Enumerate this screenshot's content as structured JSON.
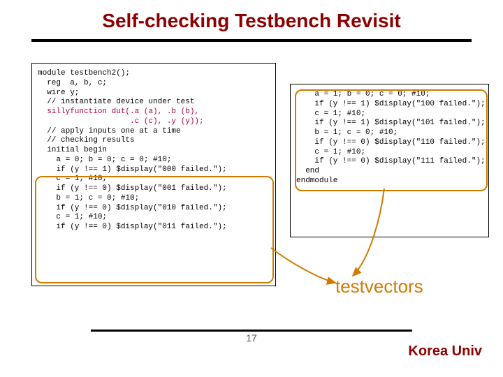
{
  "title": "Self-checking Testbench Revisit",
  "left_code": [
    {
      "t": "module testbench2();"
    },
    {
      "t": "  reg  a, b, c;"
    },
    {
      "t": "  wire y;"
    },
    {
      "t": ""
    },
    {
      "t": "  // instantiate device under test"
    },
    {
      "hl": "  sillyfunction dut(.a (a), .b (b),"
    },
    {
      "hl": "                    .c (c), .y (y));"
    },
    {
      "t": ""
    },
    {
      "t": ""
    },
    {
      "t": "  // apply inputs one at a time"
    },
    {
      "t": "  // checking results"
    },
    {
      "t": "  initial begin"
    },
    {
      "t": "    a = 0; b = 0; c = 0; #10;"
    },
    {
      "t": "    if (y !== 1) $display(\"000 failed.\");"
    },
    {
      "t": "    c = 1; #10;"
    },
    {
      "t": "    if (y !== 0) $display(\"001 failed.\");"
    },
    {
      "t": "    b = 1; c = 0; #10;"
    },
    {
      "t": "    if (y !== 0) $display(\"010 failed.\");"
    },
    {
      "t": "    c = 1; #10;"
    },
    {
      "t": "    if (y !== 0) $display(\"011 failed.\");"
    }
  ],
  "right_code": [
    {
      "t": "    a = 1; b = 0; c = 0; #10;"
    },
    {
      "t": "    if (y !== 1) $display(\"100 failed.\");"
    },
    {
      "t": "    c = 1; #10;"
    },
    {
      "t": "    if (y !== 1) $display(\"101 failed.\");"
    },
    {
      "t": "    b = 1; c = 0; #10;"
    },
    {
      "t": "    if (y !== 0) $display(\"110 failed.\");"
    },
    {
      "t": "    c = 1; #10;"
    },
    {
      "t": "    if (y !== 0) $display(\"111 failed.\");"
    },
    {
      "t": "  end"
    },
    {
      "t": ""
    },
    {
      "t": "endmodule"
    }
  ],
  "testvectors_label": "testvectors",
  "page_number": "17",
  "affiliation": "Korea Univ"
}
